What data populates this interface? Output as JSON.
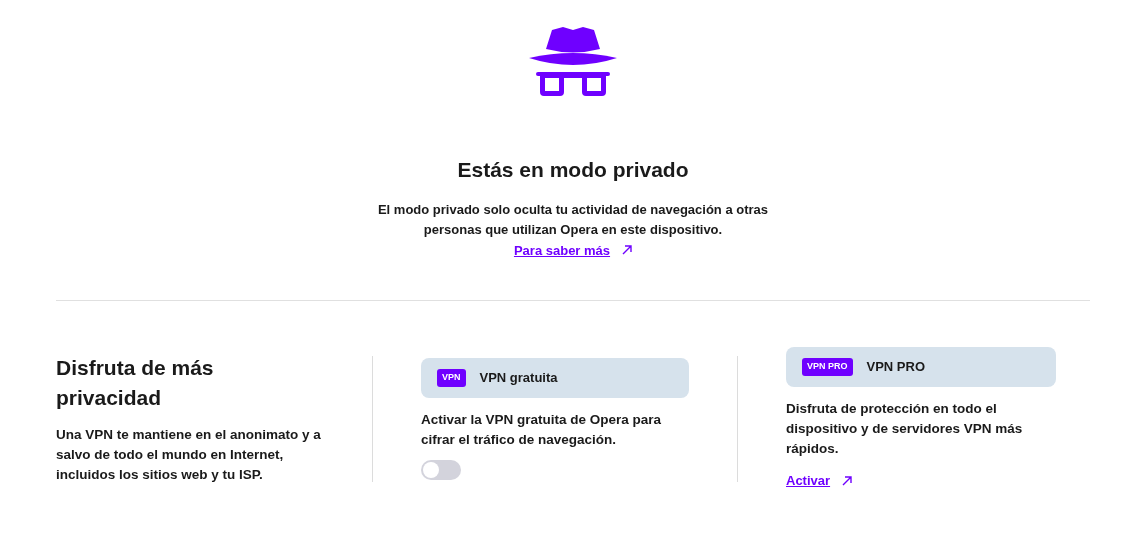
{
  "header": {
    "title": "Estás en modo privado",
    "description": "El modo privado solo oculta tu actividad de navegación a otras personas que utilizan Opera en este dispositivo.",
    "link": "Para saber más"
  },
  "promo": {
    "title": "Disfruta de más privacidad",
    "text": "Una VPN te mantiene en el anonimato y a salvo de todo el mundo en Internet, incluidos los sitios web y tu ISP."
  },
  "cards": [
    {
      "kind": "toggle",
      "badge": "VPN",
      "title": "VPN gratuita",
      "text": "Activar la VPN gratuita de Opera para cifrar el tráfico de navegación.",
      "on": false
    },
    {
      "kind": "link",
      "badge": "VPN PRO",
      "title": "VPN PRO",
      "text": "Disfruta de protección en todo el dispositivo y de servidores VPN más rápidos.",
      "link": "Activar"
    }
  ]
}
